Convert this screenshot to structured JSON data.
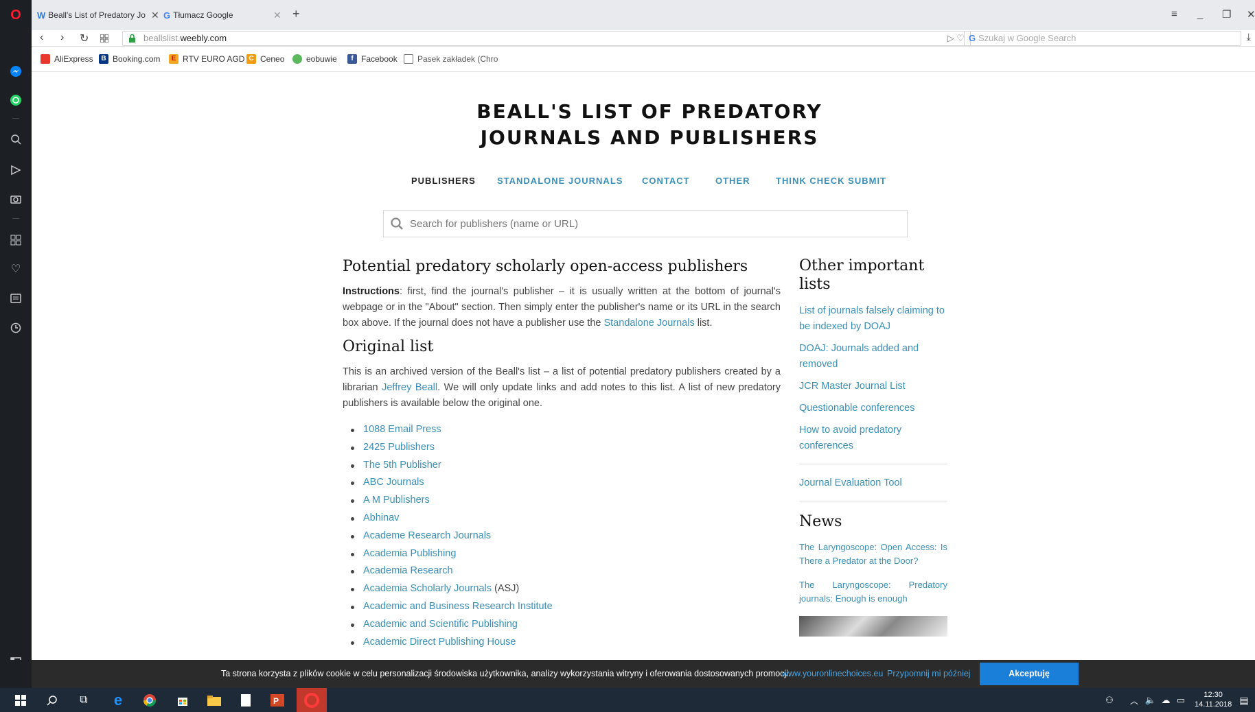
{
  "browser": {
    "tabs": [
      {
        "label": "Beall's List of Predatory Jo",
        "icon": "weebly-w-icon"
      },
      {
        "label": "Tłumacz Google",
        "icon": "google-translate-icon"
      }
    ],
    "url_gray": "beallslist.",
    "url_dark": "weebly.com",
    "search_placeholder": "Szukaj w Google Search"
  },
  "bookmarks": [
    {
      "label": "AliExpress",
      "color": "#e8372c",
      "glyph": "A"
    },
    {
      "label": "Booking.com",
      "color": "#003580",
      "glyph": "B."
    },
    {
      "label": "RTV EURO AGD",
      "color": "#f5a623",
      "glyph": "E"
    },
    {
      "label": "Ceneo",
      "color": "#f39c12",
      "glyph": "C"
    },
    {
      "label": "eobuwie",
      "color": "#5cb85c",
      "glyph": "e"
    },
    {
      "label": "Facebook",
      "color": "#3b5998",
      "glyph": "f"
    },
    {
      "label": "Pasek zakładek (Chro",
      "color": "#888888",
      "glyph": ""
    }
  ],
  "site": {
    "title_line1": "BEALL'S LIST OF PREDATORY",
    "title_line2": "JOURNALS AND PUBLISHERS",
    "nav": [
      "PUBLISHERS",
      "STANDALONE JOURNALS",
      "CONTACT",
      "OTHER",
      "THINK CHECK SUBMIT"
    ],
    "search_placeholder": "Search for publishers (name or URL)"
  },
  "main": {
    "heading": "Potential predatory scholarly open-access publishers",
    "instr_label": "Instructions",
    "instr_text1": ": first, find the journal's publisher – it is usually written at the bottom of journal's webpage or in the \"About\" section. Then simply enter the publisher's name or its URL in the search box above. If the journal does not have a publisher use the ",
    "instr_link": "Standalone Journals",
    "instr_text2": " list.",
    "orig_heading": "Original list",
    "orig_text1": "This is an archived version of the Beall's list – a list of potential predatory publishers created by a librarian ",
    "orig_link": "Jeffrey Beall",
    "orig_text2": ". We will only update links and add notes to this list. A list of new predatory publishers is available below the original one.",
    "publishers": [
      {
        "name": "1088 Email Press",
        "note": ""
      },
      {
        "name": "2425 Publishers",
        "note": ""
      },
      {
        "name": "The 5th Publisher",
        "note": ""
      },
      {
        "name": "ABC Journals",
        "note": ""
      },
      {
        "name": "A M Publishers",
        "note": ""
      },
      {
        "name": "Abhinav",
        "note": ""
      },
      {
        "name": "Academe Research Journals",
        "note": ""
      },
      {
        "name": "Academia Publishing",
        "note": ""
      },
      {
        "name": "Academia Research",
        "note": ""
      },
      {
        "name": "Academia Scholarly Journals",
        "note": " (ASJ)"
      },
      {
        "name": "Academic and Business Research Institute",
        "note": ""
      },
      {
        "name": "Academic and Scientific Publishing",
        "note": ""
      },
      {
        "name": "Academic Direct Publishing House",
        "note": ""
      }
    ]
  },
  "aside": {
    "heading": "Other important lists",
    "links": [
      "List of journals falsely claiming to be indexed by DOAJ",
      "DOAJ: Journals added and removed",
      "JCR Master Journal List",
      "Questionable conferences",
      "How to avoid predatory conferences"
    ],
    "tool_link": "Journal Evaluation Tool",
    "news_heading": "News",
    "news": [
      "The Laryngoscope: Open Access: Is There a Predator at the Door?",
      "The Laryngoscope: Predatory journals: Enough is enough"
    ]
  },
  "cookie": {
    "message": "Ta strona korzysta z plików cookie w celu personalizacji środowiska użytkownika, analizy wykorzystania witryny i oferowania dostosowanych promocji.",
    "link1": "www.youronlinechoices.eu",
    "link2": "Przypomnij mi później",
    "accept": "Akceptuję"
  },
  "clock": {
    "time": "12:30",
    "date": "14.11.2018"
  }
}
